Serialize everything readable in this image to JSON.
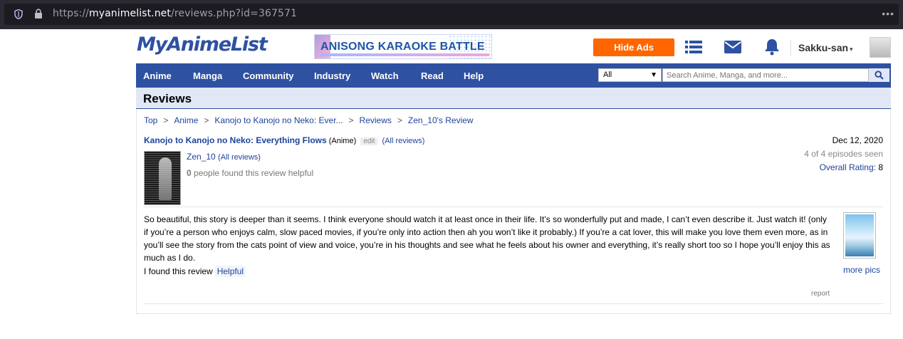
{
  "browser": {
    "url_prefix": "https://",
    "url_host": "myanimelist.net",
    "url_path": "/reviews.php?id=367571",
    "menu_glyph": "•••"
  },
  "header": {
    "logo": "MyAnimeList",
    "banner_text": "ANISONG KARAOKE BATTLE",
    "hide_ads": "Hide Ads",
    "username": "Sakku-san",
    "caret": "▾"
  },
  "nav": {
    "items": [
      "Anime",
      "Manga",
      "Community",
      "Industry",
      "Watch",
      "Read",
      "Help"
    ],
    "search_category": "All",
    "search_placeholder": "Search Anime, Manga, and more..."
  },
  "page": {
    "title": "Reviews"
  },
  "breadcrumb": [
    "Top",
    "Anime",
    "Kanojo to Kanojo no Neko: Ever...",
    "Reviews",
    "Zen_10's Review"
  ],
  "review": {
    "anime_title": "Kanojo to Kanojo no Neko: Everything Flows",
    "type": "(Anime)",
    "edit": "edit",
    "all_reviews": "(All reviews)",
    "date": "Dec 12, 2020",
    "episodes": "4 of 4 episodes seen",
    "rating_label": "Overall Rating:",
    "rating_value": "8",
    "reviewer": "Zen_10",
    "reviewer_all": "(All reviews)",
    "helpful_count": "0",
    "helpful_text": "people found this review helpful",
    "body": "So beautiful, this story is deeper than it seems. I think everyone should watch it at least once in their life. It’s so wonderfully put and made, I can’t even describe it. Just watch it! (only if you’re a person who enjoys calm, slow paced movies, if you’re only into action then ah you won’t like it probably.) If you’re a cat lover, this will make you love them even more, as in you’ll see the story from the cats point of view and voice, you’re in his thoughts and see what he feels about his owner and everything, it’s really short too so I hope you’ll enjoy this as much as I do.",
    "found_label": "I found this review",
    "helpful_button": "Helpful",
    "more_pics": "more pics",
    "report": "report"
  },
  "colors": {
    "brand": "#2e51a2",
    "hide_ads": "#ff6600",
    "link": "#1c439b"
  }
}
